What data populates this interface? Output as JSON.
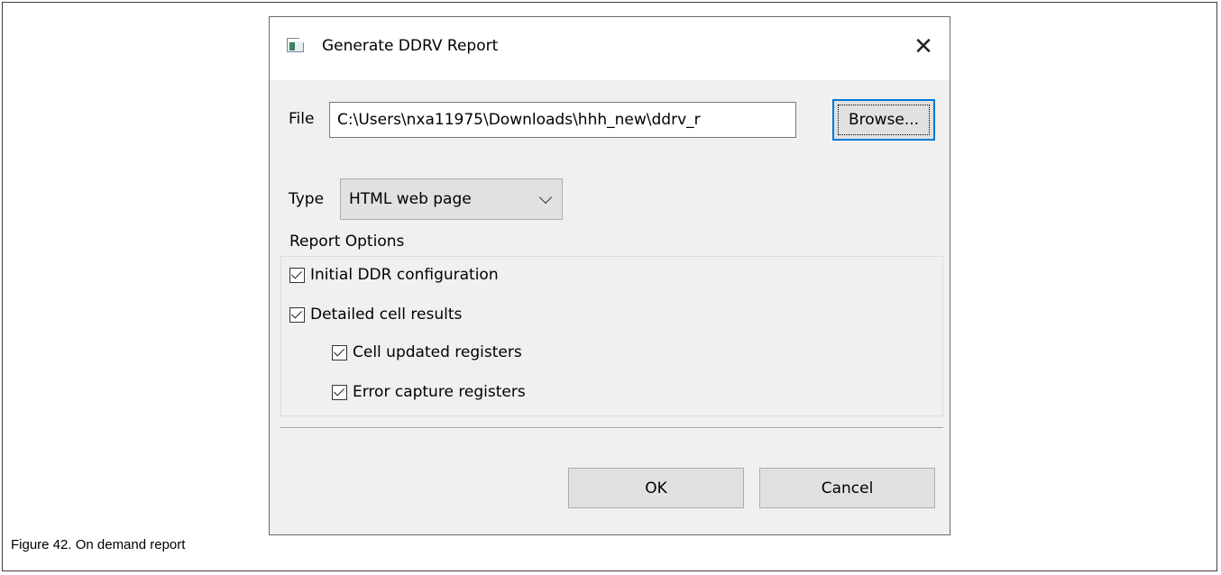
{
  "dialog": {
    "title": "Generate DDRV Report",
    "close_glyph": "✕",
    "icon": "app-window-icon"
  },
  "file": {
    "label": "File",
    "value": "C:\\Users\\nxa11975\\Downloads\\hhh_new\\ddrv_r",
    "browse_label": "Browse..."
  },
  "type": {
    "label": "Type",
    "selected": "HTML web page"
  },
  "report_options": {
    "title": "Report Options",
    "items": [
      {
        "label": "Initial DDR configuration",
        "checked": true
      },
      {
        "label": "Detailed cell results",
        "checked": true
      },
      {
        "label": "Cell updated registers",
        "checked": true
      },
      {
        "label": "Error capture registers",
        "checked": true
      }
    ]
  },
  "buttons": {
    "ok_label": "OK",
    "cancel_label": "Cancel"
  },
  "figure": {
    "caption": "Figure 42. On demand report"
  },
  "colors": {
    "dialog_bg": "#f0f0f0",
    "focus_accent": "#0078d7",
    "button_bg": "#e1e1e1"
  }
}
